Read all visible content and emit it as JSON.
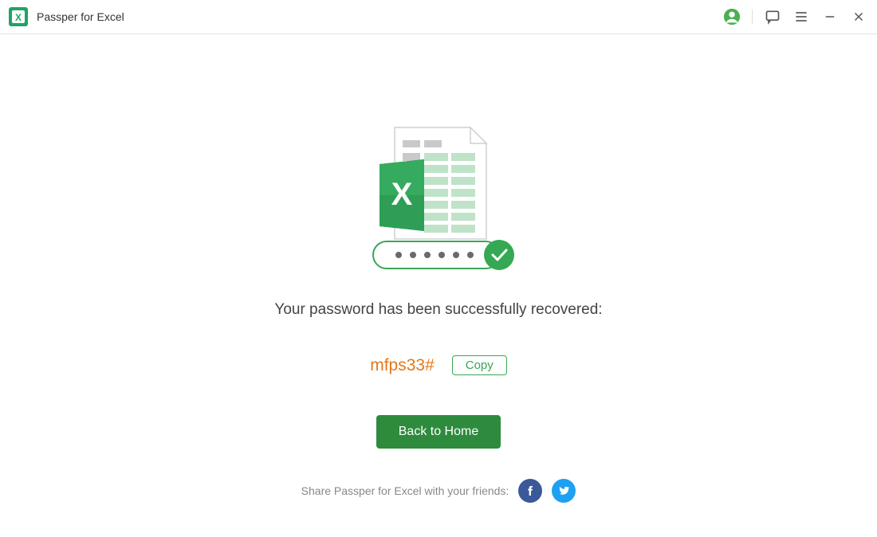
{
  "app": {
    "title": "Passper for Excel"
  },
  "main": {
    "message": "Your password has been successfully recovered:",
    "password": "mfps33#",
    "copy_label": "Copy",
    "home_label": "Back to Home",
    "share_text": "Share Passper for Excel with your friends:"
  }
}
